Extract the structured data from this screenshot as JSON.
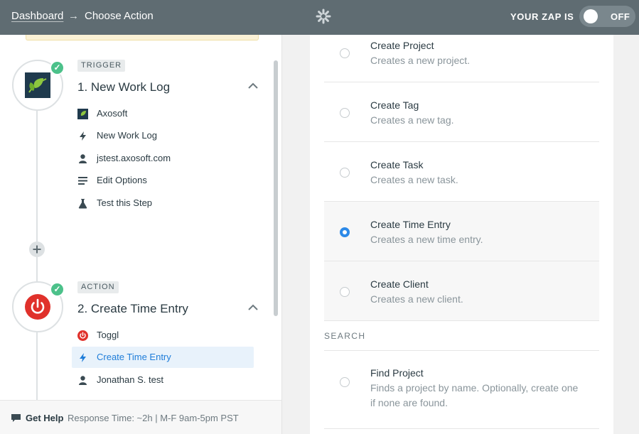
{
  "header": {
    "breadcrumb_home": "Dashboard",
    "breadcrumb_sep": "→",
    "breadcrumb_current": "Choose Action",
    "zap_status_label": "YOUR ZAP IS",
    "toggle_state": "OFF"
  },
  "steps": [
    {
      "tag": "TRIGGER",
      "title": "1. New Work Log",
      "items": [
        {
          "label": "Axosoft",
          "icon": "axosoft-icon"
        },
        {
          "label": "New Work Log",
          "icon": "bolt-icon"
        },
        {
          "label": "jstest.axosoft.com",
          "icon": "user-icon"
        },
        {
          "label": "Edit Options",
          "icon": "lines-icon"
        },
        {
          "label": "Test this Step",
          "icon": "flask-icon"
        }
      ]
    },
    {
      "tag": "ACTION",
      "title": "2. Create Time Entry",
      "items": [
        {
          "label": "Toggl",
          "icon": "toggl-icon"
        },
        {
          "label": "Create Time Entry",
          "icon": "bolt-icon",
          "active": true
        },
        {
          "label": "Jonathan S. test",
          "icon": "user-icon"
        }
      ]
    }
  ],
  "help": {
    "link": "Get Help",
    "text": "Response Time: ~2h | M-F 9am-5pm PST"
  },
  "actions": [
    {
      "title": "Create Project",
      "desc": "Creates a new project."
    },
    {
      "title": "Create Tag",
      "desc": "Creates a new tag."
    },
    {
      "title": "Create Task",
      "desc": "Creates a new task."
    },
    {
      "title": "Create Time Entry",
      "desc": "Creates a new time entry.",
      "selected": true
    },
    {
      "title": "Create Client",
      "desc": "Creates a new client."
    }
  ],
  "search_section": "SEARCH",
  "searches": [
    {
      "title": "Find Project",
      "desc": "Finds a project by name. Optionally, create one if none are found."
    }
  ],
  "colors": {
    "header_bg": "#5f6c72",
    "accent_blue": "#2d8ae8",
    "success_green": "#4cc18a",
    "toggl_red": "#e0312b",
    "axosoft_navy": "#1f3a4d"
  }
}
